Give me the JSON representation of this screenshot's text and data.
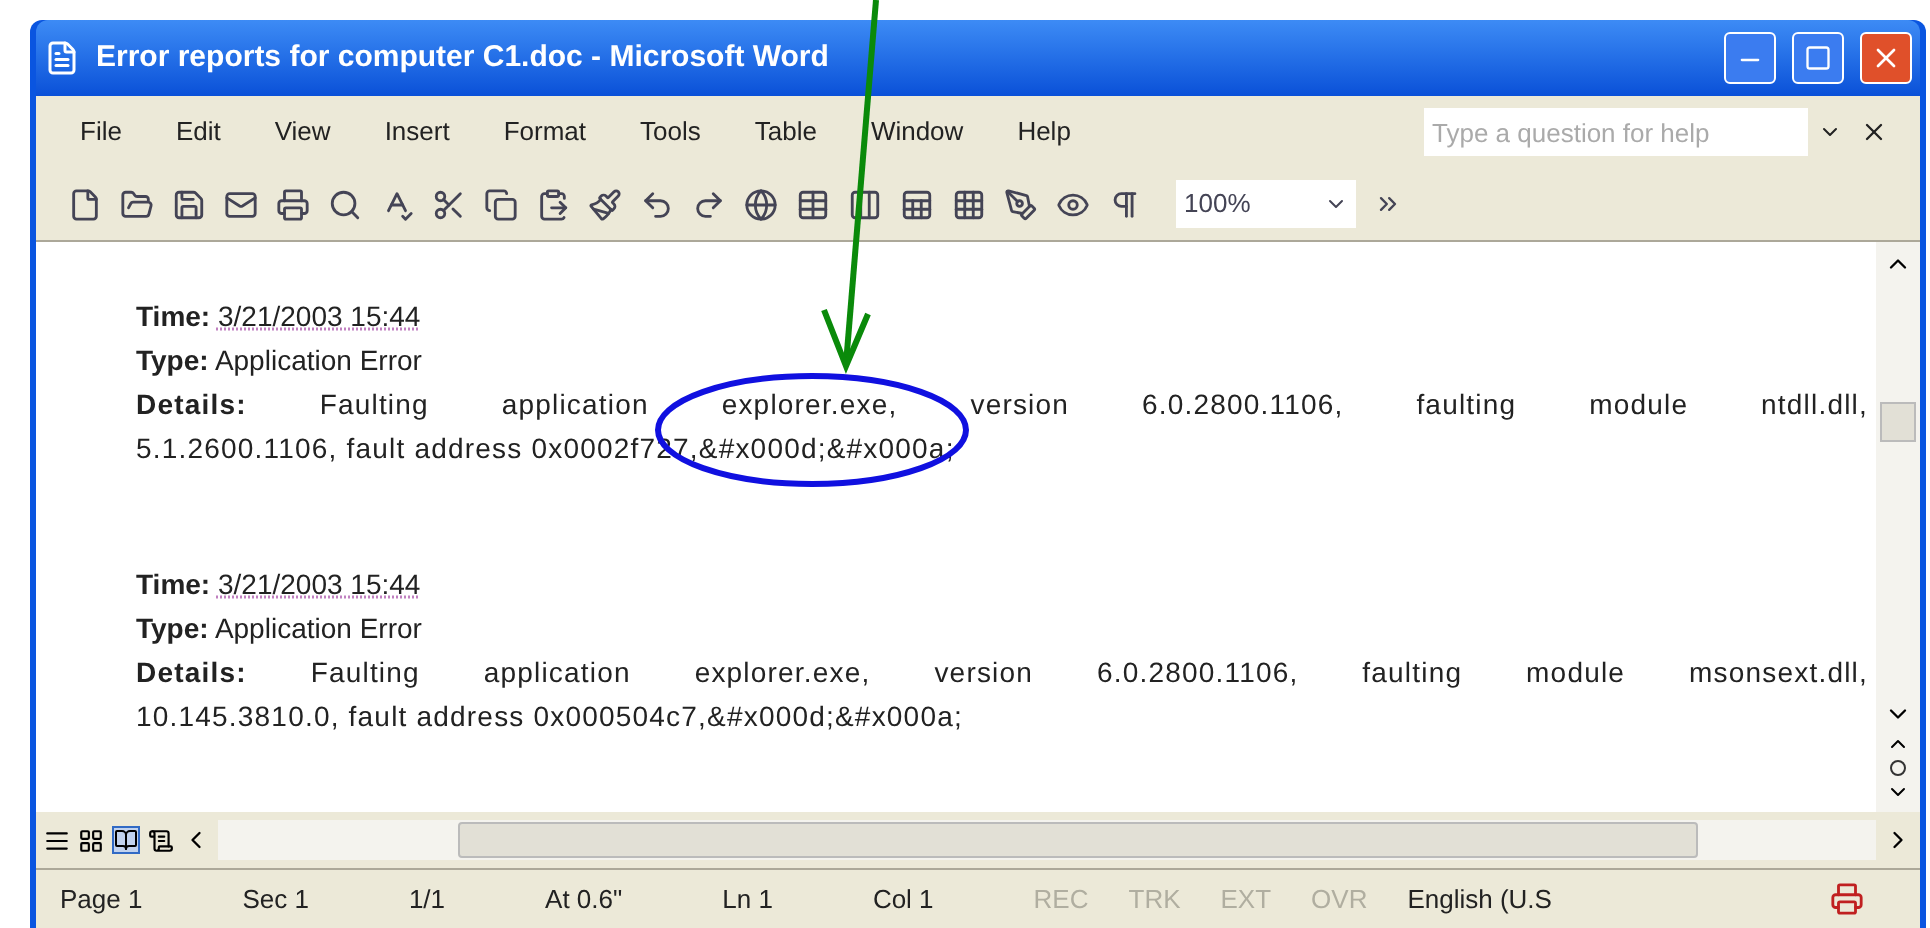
{
  "window": {
    "title": "Error reports for computer C1.doc - Microsoft Word"
  },
  "menu": [
    "File",
    "Edit",
    "View",
    "Insert",
    "Format",
    "Tools",
    "Table",
    "Window",
    "Help"
  ],
  "help_search": {
    "placeholder": "Type a question for help"
  },
  "zoom": "100%",
  "records": [
    {
      "time_label": "Time:",
      "time": "3/21/2003 15:44",
      "type_label": "Type:",
      "type": "Application Error",
      "details_label": "Details:",
      "details_lines": [
        "Faulting application explorer.exe, version 6.0.2800.1106, faulting module ntdll.dll,",
        "5.1.2600.1106, fault address 0x0002f727,&#x000d;&#x000a;"
      ]
    },
    {
      "time_label": "Time:",
      "time": "3/21/2003 15:44",
      "type_label": "Type:",
      "type": "Application Error",
      "details_label": "Details:",
      "details_lines": [
        "Faulting application explorer.exe, version 6.0.2800.1106, faulting module msonsext.dll,",
        "10.145.3810.0, fault address 0x000504c7,&#x000d;&#x000a;"
      ]
    }
  ],
  "status_bar": [
    {
      "text": "Page 1",
      "disabled": false
    },
    {
      "text": "Sec 1",
      "disabled": false
    },
    {
      "text": "1/1",
      "disabled": false
    },
    {
      "text": "At 0.6\"",
      "disabled": false
    },
    {
      "text": "Ln 1",
      "disabled": false
    },
    {
      "text": "Col 1",
      "disabled": false
    },
    {
      "text": "REC",
      "disabled": true
    },
    {
      "text": "TRK",
      "disabled": true
    },
    {
      "text": "EXT",
      "disabled": true
    },
    {
      "text": "OVR",
      "disabled": true
    },
    {
      "text": "English (U.S",
      "disabled": false
    }
  ]
}
